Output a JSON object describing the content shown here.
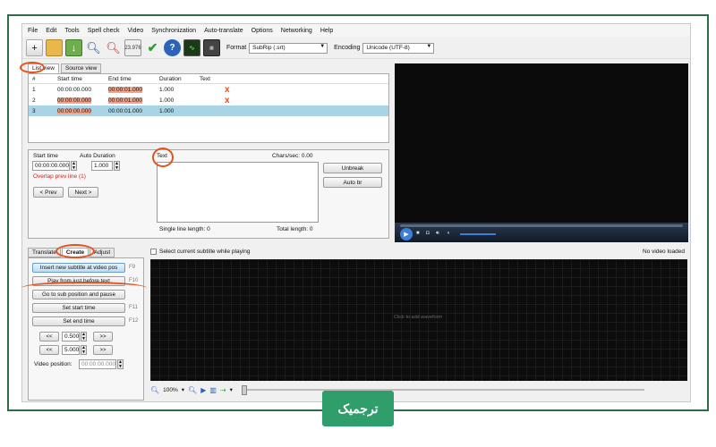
{
  "menu": [
    "File",
    "Edit",
    "Tools",
    "Spell check",
    "Video",
    "Synchronization",
    "Auto-translate",
    "Options",
    "Networking",
    "Help"
  ],
  "toolbar": {
    "fps_icon": "23.976",
    "format_label": "Format",
    "format_value": "SubRip (.srt)",
    "encoding_label": "Encoding",
    "encoding_value": "Unicode (UTF-8)"
  },
  "tabs_top": [
    "List view",
    "Source view"
  ],
  "subtitle_list": {
    "columns": [
      "#",
      "Start time",
      "End time",
      "Duration",
      "Text"
    ],
    "rows": [
      {
        "num": "1",
        "start": "00:00:00.000",
        "end": "00:00:01.000",
        "duration": "1.000",
        "text": "",
        "mark": "x"
      },
      {
        "num": "2",
        "start": "00:00:00.000",
        "end": "00:00:01.000",
        "duration": "1.000",
        "text": "",
        "mark": "x"
      },
      {
        "num": "3",
        "start": "00:00:00.000",
        "end": "00:00:01.000",
        "duration": "1.000",
        "text": "",
        "mark": ""
      }
    ]
  },
  "editor": {
    "start_time_label": "Start time",
    "auto_duration_label": "Auto Duration",
    "start_time_value": "00:00:00.000",
    "duration_value": "1.000",
    "overlap_warning": "Overlap prev line (1)",
    "prev_button": "< Prev",
    "next_button": "Next >",
    "text_label": "Text",
    "chars_sec": "Chars/sec: 0.00",
    "unbreak_button": "Unbreak",
    "auto_br_button": "Auto br",
    "single_line_length": "Single line length: 0",
    "total_length": "Total length: 0"
  },
  "tabs_bottom": [
    "Translate",
    "Create",
    "Adjust"
  ],
  "create_panel": {
    "insert_button": "Insert new subtitle at video pos",
    "insert_key": "F9",
    "play_button": "Play from just before text",
    "play_key": "F10",
    "goto_button": "Go to sub position and pause",
    "set_start_button": "Set start time",
    "set_start_key": "F11",
    "set_end_button": "Set end time",
    "set_end_key": "F12",
    "back_label": "<<",
    "forward_label": ">>",
    "step1": "0.500",
    "step2": "5.000",
    "video_position_label": "Video position:",
    "video_position_value": "00:00:00.000"
  },
  "waveform": {
    "checkbox_label": "Select current subtitle while playing",
    "no_video": "No video loaded",
    "click_hint": "Click to add waveform",
    "zoom": "100%"
  },
  "watermark": "ترجمیک",
  "colors": {
    "frame": "#2e6b46",
    "highlight": "#f4a48a",
    "selected_row": "#a9d4e6",
    "annotation": "#e0521e",
    "badge": "#2f9e6a"
  }
}
